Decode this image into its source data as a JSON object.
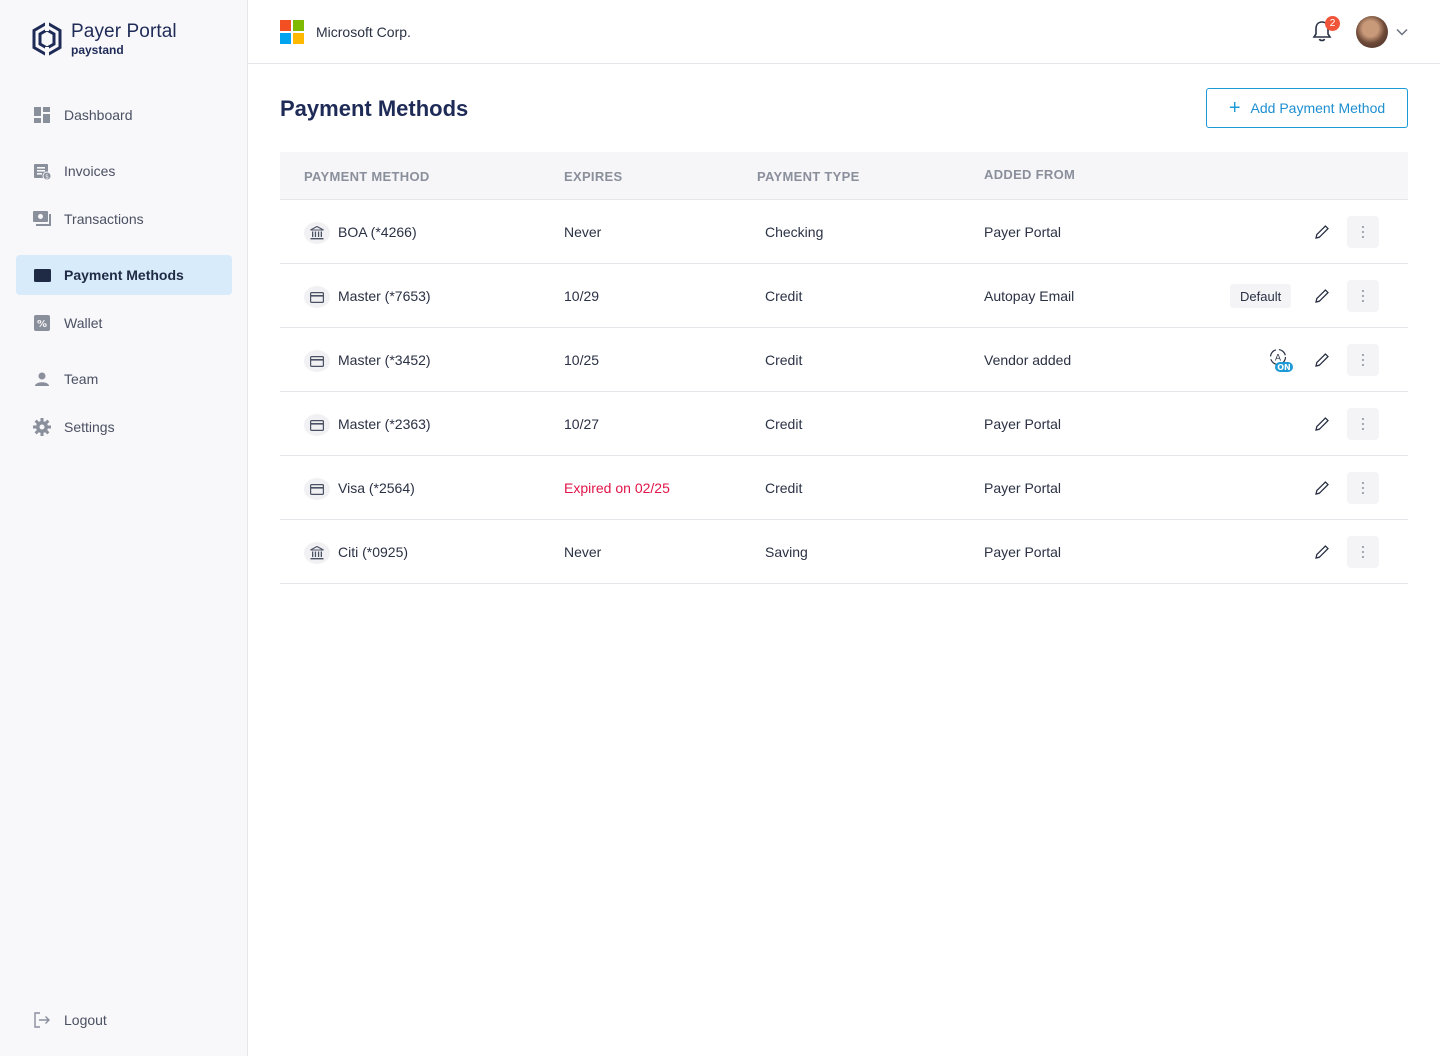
{
  "brand": {
    "title": "Payer Portal",
    "subtitle": "paystand"
  },
  "sidebar": {
    "items": [
      {
        "label": "Dashboard",
        "icon": "dashboard-icon"
      },
      {
        "label": "Invoices",
        "icon": "invoice-icon"
      },
      {
        "label": "Transactions",
        "icon": "transactions-icon"
      },
      {
        "label": "Payment Methods",
        "icon": "credit-card-icon",
        "active": true
      },
      {
        "label": "Wallet",
        "icon": "wallet-icon"
      },
      {
        "label": "Team",
        "icon": "person-icon"
      },
      {
        "label": "Settings",
        "icon": "gear-icon"
      }
    ],
    "logout": "Logout"
  },
  "header": {
    "company": "Microsoft Corp.",
    "notification_count": "2"
  },
  "main": {
    "title": "Payment Methods",
    "add_button": "Add Payment Method",
    "columns": [
      "PAYMENT METHOD",
      "EXPIRES",
      "PAYMENT TYPE",
      "ADDED FROM"
    ],
    "rows": [
      {
        "name": "BOA (*4266)",
        "kind": "bank",
        "expires": "Never",
        "type": "Checking",
        "added_from": "Payer Portal",
        "tag": ""
      },
      {
        "name": "Master (*7653)",
        "kind": "card",
        "expires": "10/29",
        "type": "Credit",
        "added_from": "Autopay Email",
        "tag": "Default"
      },
      {
        "name": "Master (*3452)",
        "kind": "card",
        "expires": "10/25",
        "type": "Credit",
        "added_from": "Vendor added",
        "tag": "ON"
      },
      {
        "name": "Master (*2363)",
        "kind": "card",
        "expires": "10/27",
        "type": "Credit",
        "added_from": "Payer Portal",
        "tag": ""
      },
      {
        "name": "Visa (*2564)",
        "kind": "card",
        "expires": "Expired on 02/25",
        "type": "Credit",
        "added_from": "Payer Portal",
        "tag": "",
        "expired": true
      },
      {
        "name": "Citi (*0925)",
        "kind": "bank",
        "expires": "Never",
        "type": "Saving",
        "added_from": "Payer Portal",
        "tag": ""
      }
    ]
  },
  "colors": {
    "accent": "#1d9ad6",
    "brand_navy": "#1e2b57",
    "active_nav_bg": "#d8ebfa",
    "expired": "#e0154a",
    "badge": "#f0553a"
  }
}
